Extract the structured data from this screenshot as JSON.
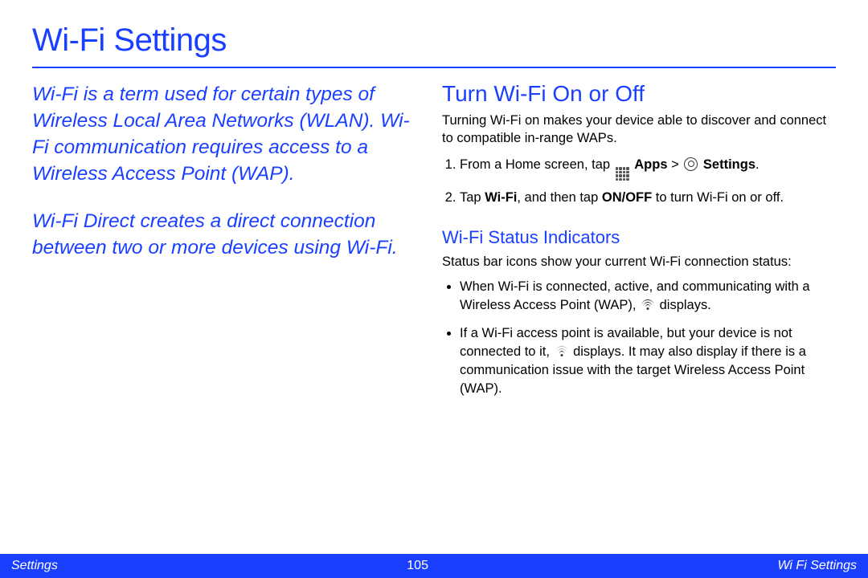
{
  "page": {
    "title": "Wi-Fi Settings"
  },
  "intro": {
    "p1": "Wi-Fi is a term used for certain types of Wireless Local Area Networks (WLAN). Wi-Fi communication requires access to a Wireless Access Point (WAP).",
    "p2": "Wi-Fi Direct creates a direct connection between two or more devices using Wi-Fi."
  },
  "section1": {
    "heading": "Turn Wi-Fi On or Off",
    "body": "Turning Wi-Fi on makes your device able to discover and connect to compatible in-range WAPs.",
    "step1_pre": "From a Home screen, tap ",
    "step1_apps": "Apps",
    "step1_gt": " > ",
    "step1_settings": "Settings",
    "step1_post": ".",
    "step2_pre": "Tap ",
    "step2_wifi": "Wi-Fi",
    "step2_mid": ", and then tap ",
    "step2_onoff": "ON/OFF",
    "step2_post": " to turn Wi-Fi on or off."
  },
  "section2": {
    "heading": "Wi-Fi Status Indicators",
    "body": "Status bar icons show your current Wi-Fi connection status:",
    "bullet1_pre": "When Wi-Fi is connected, active, and communicating with a Wireless Access Point (WAP), ",
    "bullet1_post": " displays.",
    "bullet2_pre": "If a Wi-Fi access point is available, but your device is not connected to it, ",
    "bullet2_post": " displays. It may also display if there is a communication issue with the target Wireless Access Point (WAP)."
  },
  "footer": {
    "left": "Settings",
    "page_number": "105",
    "right": "Wi Fi Settings"
  }
}
